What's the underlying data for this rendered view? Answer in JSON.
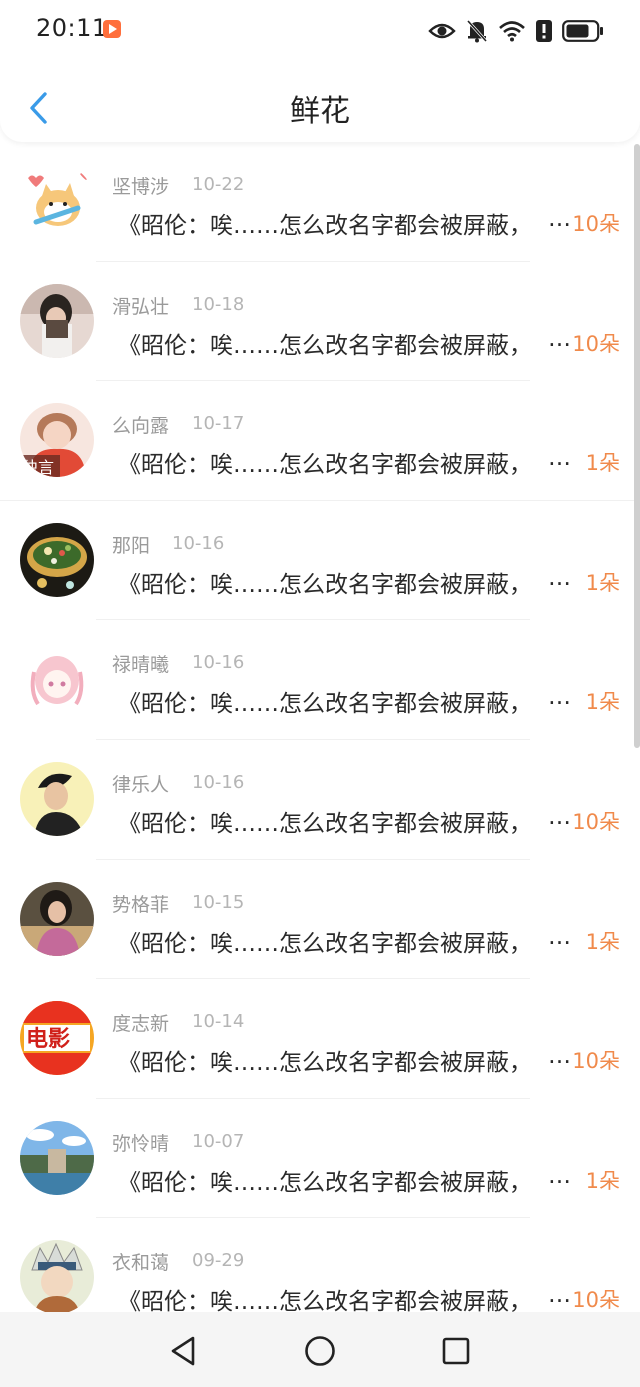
{
  "status_bar": {
    "time": "20:11",
    "icons": [
      "app-notification-icon",
      "eye-icon",
      "bell-off-icon",
      "wifi-icon",
      "alert-icon",
      "battery-icon"
    ]
  },
  "header": {
    "title": "鲜花",
    "back_icon": "chevron-left-icon",
    "accent": "#3a9be8"
  },
  "colors": {
    "count": "#f08a4b",
    "name": "#9a9a9a",
    "date": "#b5b5b5",
    "message": "#2a2a2a"
  },
  "items": [
    {
      "name": "坚博涉",
      "date": "10-22",
      "message": "《昭伦：唉……怎么改名字都会被屏蔽，",
      "count": "10朵",
      "avatar": "cartoon-cat-avatar"
    },
    {
      "name": "滑弘壮",
      "date": "10-18",
      "message": "《昭伦：唉……怎么改名字都会被屏蔽，",
      "count": "10朵",
      "avatar": "person-with-book-avatar"
    },
    {
      "name": "么向露",
      "date": "10-17",
      "message": "《昭伦：唉……怎么改名字都会被屏蔽，",
      "count": "1朵",
      "avatar": "girl-red-scarf-avatar",
      "avatar_text": "独言"
    },
    {
      "name": "那阳",
      "date": "10-16",
      "message": "《昭伦：唉……怎么改名字都会被屏蔽，",
      "count": "1朵",
      "avatar": "food-bowl-avatar"
    },
    {
      "name": "禄晴曦",
      "date": "10-16",
      "message": "《昭伦：唉……怎么改名字都会被屏蔽，",
      "count": "1朵",
      "avatar": "anime-girl-avatar"
    },
    {
      "name": "律乐人",
      "date": "10-16",
      "message": "《昭伦：唉……怎么改名字都会被屏蔽，",
      "count": "10朵",
      "avatar": "young-man-avatar"
    },
    {
      "name": "势格菲",
      "date": "10-15",
      "message": "《昭伦：唉……怎么改名字都会被屏蔽，",
      "count": "1朵",
      "avatar": "woman-portrait-avatar"
    },
    {
      "name": "度志新",
      "date": "10-14",
      "message": "《昭伦：唉……怎么改名字都会被屏蔽，",
      "count": "10朵",
      "avatar": "movie-logo-avatar",
      "avatar_text": "电影"
    },
    {
      "name": "弥怜晴",
      "date": "10-07",
      "message": "《昭伦：唉……怎么改名字都会被屏蔽，",
      "count": "1朵",
      "avatar": "landscape-avatar"
    },
    {
      "name": "衣和蔼",
      "date": "09-29",
      "message": "《昭伦：唉……怎么改名字都会被屏蔽，",
      "count": "10朵",
      "avatar": "anime-boy-avatar"
    }
  ],
  "list_ellipsis": "…",
  "system_nav": [
    "back-triangle-icon",
    "home-circle-icon",
    "recents-square-icon"
  ]
}
